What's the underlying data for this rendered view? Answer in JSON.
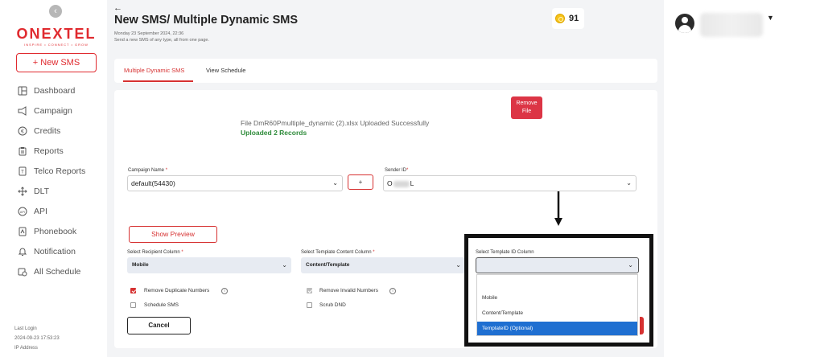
{
  "sidebar": {
    "logo_main": "ONEXTEL",
    "logo_sub": "INSPIRE • CONNECT • GROW",
    "new_sms_label": "+ New SMS",
    "items": [
      {
        "label": "Dashboard",
        "icon": "dashboard-icon"
      },
      {
        "label": "Campaign",
        "icon": "megaphone-icon"
      },
      {
        "label": "Credits",
        "icon": "currency-icon"
      },
      {
        "label": "Reports",
        "icon": "clipboard-icon"
      },
      {
        "label": "Telco Reports",
        "icon": "document-icon"
      },
      {
        "label": "DLT",
        "icon": "move-icon"
      },
      {
        "label": "API",
        "icon": "api-icon"
      },
      {
        "label": "Phonebook",
        "icon": "phonebook-icon"
      },
      {
        "label": "Notification",
        "icon": "bell-icon"
      },
      {
        "label": "All Schedule",
        "icon": "schedule-icon"
      }
    ],
    "last_login_label": "Last Login",
    "last_login_value": "2024-09-23 17:53:23",
    "ip_label": "IP Address"
  },
  "header": {
    "title": "New SMS/ Multiple Dynamic SMS",
    "date": "Monday 23 September 2024, 22:36",
    "subtitle": "Send a new SMS of any type, all from one page.",
    "credits": "91"
  },
  "tabs": [
    {
      "label": "Multiple Dynamic SMS",
      "active": true
    },
    {
      "label": "View Schedule",
      "active": false
    }
  ],
  "upload": {
    "remove_label_1": "Remove",
    "remove_label_2": "File",
    "message": "File DmR60Pmultiple_dynamic (2).xlsx Uploaded Successfully",
    "count": "Uploaded 2 Records"
  },
  "form": {
    "campaign_label": "Campaign Name",
    "campaign_value": "default(54430)",
    "plus_label": "+",
    "sender_label": "Sender ID",
    "sender_prefix": "O",
    "sender_suffix": "L",
    "show_preview": "Show Preview",
    "recipient_label": "Select Recipient Column",
    "recipient_value": "Mobile",
    "content_label": "Select Template Content Column",
    "content_value": "Content/Template",
    "template_id_label": "Select Template ID Column",
    "template_id_value": "",
    "required_mark": "*",
    "checkboxes": {
      "remove_duplicates": "Remove Duplicate Numbers",
      "remove_invalid": "Remove Invalid Numbers",
      "schedule_sms": "Schedule SMS",
      "scrub_dnd": "Scrub DND"
    },
    "cancel_label": "Cancel"
  },
  "dropdown": {
    "options": [
      "Mobile",
      "Content/Template",
      "TemplateID (Optional)"
    ],
    "selected_index": 2
  },
  "colors": {
    "brand": "#e02a2f",
    "success": "#2e8b3a",
    "highlight": "#1f6fd1"
  }
}
